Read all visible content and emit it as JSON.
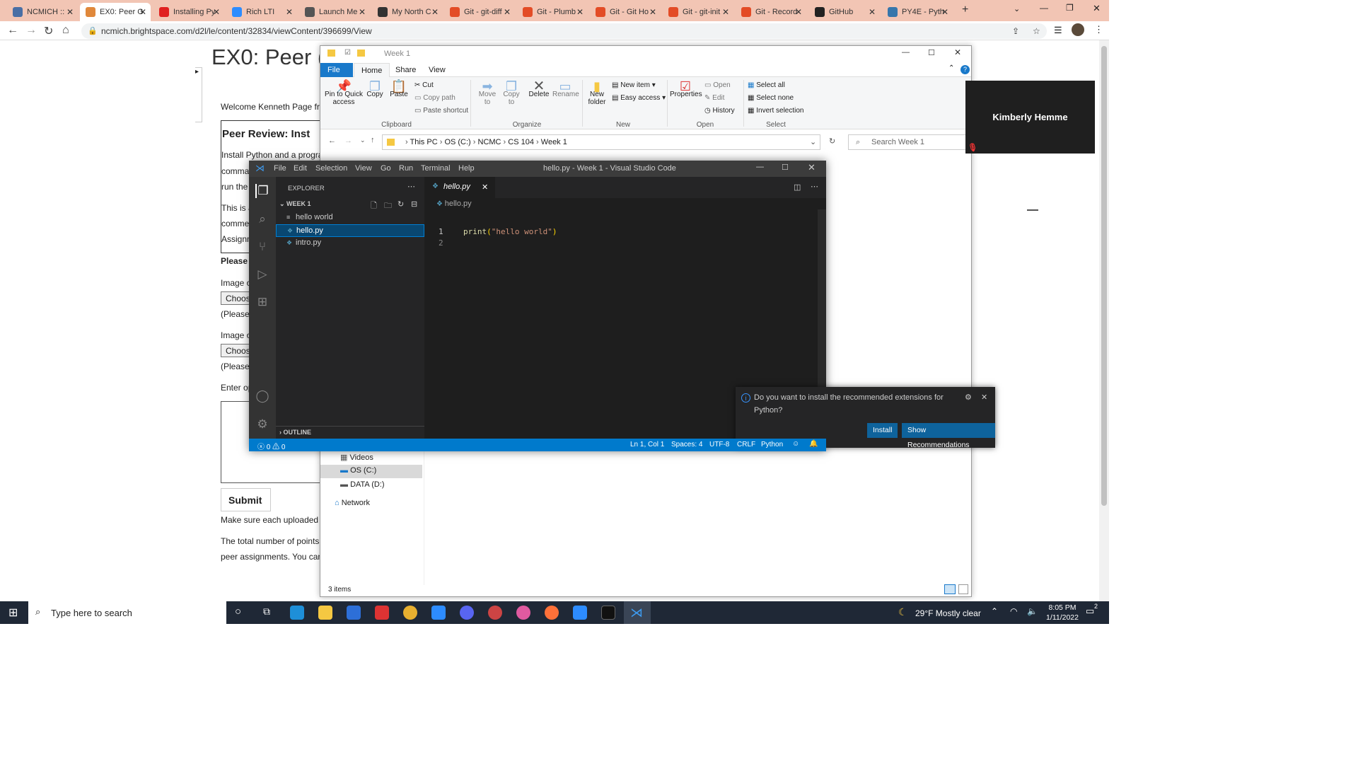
{
  "browser": {
    "tabs": [
      {
        "label": "NCMICH :: ",
        "color": "#4a6fa5"
      },
      {
        "label": "EX0: Peer G",
        "color": "#e0883b"
      },
      {
        "label": "Installing Py",
        "color": "#e02020"
      },
      {
        "label": "Rich LTI",
        "color": "#2d8cff"
      },
      {
        "label": "Launch Me",
        "color": "#555555"
      },
      {
        "label": "My North C",
        "color": "#333333"
      },
      {
        "label": "Git - git-diff",
        "color": "#e34c26"
      },
      {
        "label": "Git - Plumb",
        "color": "#e34c26"
      },
      {
        "label": "Git - Git Ho",
        "color": "#e34c26"
      },
      {
        "label": "Git - git-init",
        "color": "#e34c26"
      },
      {
        "label": "Git - Record",
        "color": "#e34c26"
      },
      {
        "label": "GitHub",
        "color": "#222222"
      },
      {
        "label": "PY4E - Pyth",
        "color": "#3776ab"
      }
    ],
    "url": "ncmich.brightspace.com/d2l/le/content/32834/viewContent/396699/View"
  },
  "page": {
    "title": "EX0: Peer (",
    "welcome": "Welcome Kenneth Page fro",
    "review_heading": "Peer Review: Inst",
    "install_line": "Install Python and a program",
    "comm": "comma",
    "run": "run the",
    "this": "This is a",
    "comme": "comme",
    "assign": "Assignm",
    "please": "Please",
    "image1": "Image o",
    "choose1": "Choos",
    "please_note1": "(Please",
    "image2": "Image o",
    "choose2": "Choos",
    "please_note2": "(Please",
    "enter": "Enter op",
    "submit": "Submit",
    "make_sure": "Make sure each uploaded in",
    "total": "The total number of points fo",
    "peer": "peer assignments. You can"
  },
  "explorer": {
    "title": "Week 1",
    "tabs": {
      "file": "File",
      "home": "Home",
      "share": "Share",
      "view": "View"
    },
    "ribbon": {
      "pin": "Pin to Quick access",
      "copy": "Copy",
      "paste": "Paste",
      "cut": "Cut",
      "copy_path": "Copy path",
      "paste_shortcut": "Paste shortcut",
      "move_to": "Move to",
      "copy_to": "Copy to",
      "delete": "Delete",
      "rename": "Rename",
      "new_folder": "New folder",
      "new_item": "New item",
      "easy_access": "Easy access",
      "properties": "Properties",
      "open": "Open",
      "edit": "Edit",
      "history": "History",
      "select_all": "Select all",
      "select_none": "Select none",
      "invert_selection": "Invert selection",
      "groups": {
        "clipboard": "Clipboard",
        "organize": "Organize",
        "new": "New",
        "open": "Open",
        "select": "Select"
      }
    },
    "path": [
      "This PC",
      "OS (C:)",
      "NCMC",
      "CS 104",
      "Week 1"
    ],
    "search_placeholder": "Search Week 1",
    "nav": {
      "videos": "Videos",
      "os": "OS (C:)",
      "data": "DATA (D:)",
      "network": "Network"
    },
    "status": "3 items"
  },
  "vscode": {
    "menus": [
      "File",
      "Edit",
      "Selection",
      "View",
      "Go",
      "Run",
      "Terminal",
      "Help"
    ],
    "title": "hello.py - Week 1 - Visual Studio Code",
    "explorer_label": "EXPLORER",
    "folder": "WEEK 1",
    "files": [
      "hello world",
      "hello.py",
      "intro.py"
    ],
    "outline": "OUTLINE",
    "tab": "hello.py",
    "breadcrumb": "hello.py",
    "code": [
      {
        "n": "1",
        "t": "print(\"hello world\")"
      },
      {
        "n": "2",
        "t": ""
      }
    ],
    "notification": {
      "text1": "Do you want to install the recommended extensions for",
      "text2": "Python?",
      "install": "Install",
      "show": "Show Recommendations"
    },
    "status": {
      "problems": "ⓧ 0 ⚠ 0",
      "pos": "Ln 1, Col 1",
      "spaces": "Spaces: 4",
      "enc": "UTF-8",
      "eol": "CRLF",
      "lang": "Python"
    }
  },
  "meeting": {
    "name": "Kimberly Hemme"
  },
  "taskbar": {
    "search": "Type here to search",
    "weather": "29°F  Mostly clear",
    "time": "8:05 PM",
    "date": "1/11/2022",
    "notif_count": "2"
  }
}
